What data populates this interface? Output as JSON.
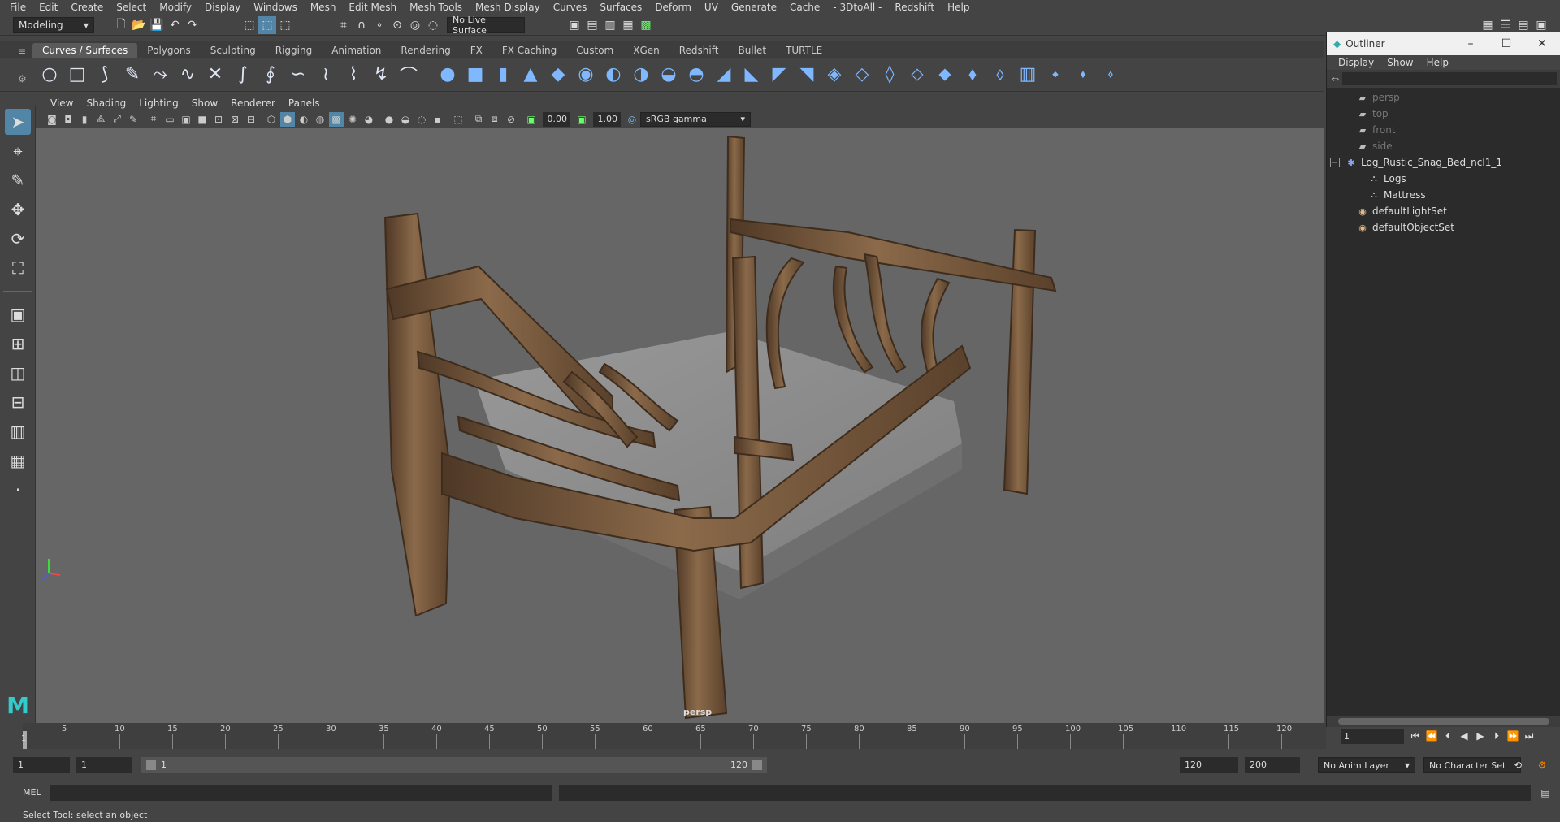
{
  "menubar": {
    "items": [
      "File",
      "Edit",
      "Create",
      "Select",
      "Modify",
      "Display",
      "Windows",
      "Mesh",
      "Edit Mesh",
      "Mesh Tools",
      "Mesh Display",
      "Curves",
      "Surfaces",
      "Deform",
      "UV",
      "Generate",
      "Cache",
      "- 3DtoAll -",
      "Redshift",
      "Help"
    ]
  },
  "status": {
    "mode": "Modeling",
    "live_surface": "No Live Surface"
  },
  "shelf": {
    "tabs": [
      "Curves / Surfaces",
      "Polygons",
      "Sculpting",
      "Rigging",
      "Animation",
      "Rendering",
      "FX",
      "FX Caching",
      "Custom",
      "XGen",
      "Redshift",
      "Bullet",
      "TURTLE"
    ],
    "active_tab": "Curves / Surfaces"
  },
  "viewport": {
    "menu": [
      "View",
      "Shading",
      "Lighting",
      "Show",
      "Renderer",
      "Panels"
    ],
    "exposure": "0.00",
    "gamma": "1.00",
    "color_space": "sRGB gamma",
    "camera_label": "persp"
  },
  "outliner": {
    "title": "Outliner",
    "menu": [
      "Display",
      "Show",
      "Help"
    ],
    "rows": [
      {
        "label": "persp",
        "icon": "camera-icon",
        "indent": 2,
        "dim": true
      },
      {
        "label": "top",
        "icon": "camera-icon",
        "indent": 2,
        "dim": true
      },
      {
        "label": "front",
        "icon": "camera-icon",
        "indent": 2,
        "dim": true
      },
      {
        "label": "side",
        "icon": "camera-icon",
        "indent": 2,
        "dim": true
      },
      {
        "label": "Log_Rustic_Snag_Bed_ncl1_1",
        "icon": "group-icon",
        "indent": 1,
        "dim": false,
        "expand": "−"
      },
      {
        "label": "Logs",
        "icon": "mesh-icon",
        "indent": 3,
        "dim": false
      },
      {
        "label": "Mattress",
        "icon": "mesh-icon",
        "indent": 3,
        "dim": false
      },
      {
        "label": "defaultLightSet",
        "icon": "set-icon",
        "indent": 2,
        "dim": false
      },
      {
        "label": "defaultObjectSet",
        "icon": "set-icon",
        "indent": 2,
        "dim": false
      }
    ]
  },
  "timeline": {
    "ticks": [
      "5",
      "10",
      "15",
      "20",
      "25",
      "30",
      "35",
      "40",
      "45",
      "50",
      "55",
      "60",
      "65",
      "70",
      "75",
      "80",
      "85",
      "90",
      "95",
      "100",
      "105",
      "110",
      "115",
      "120"
    ],
    "start_label": "1",
    "current_frame": "1"
  },
  "range": {
    "start": "1",
    "playback_start": "1",
    "slider_start": "1",
    "slider_end": "120",
    "playback_end": "120",
    "end": "200",
    "anim_layer": "No Anim Layer",
    "character_set": "No Character Set"
  },
  "cmdline": {
    "label": "MEL"
  },
  "helpline": {
    "text": "Select Tool: select an object"
  },
  "colors": {
    "wood": "#6e5238",
    "wood_light": "#8b6a4a",
    "mattress": "#8e8e8e",
    "accent": "#5285a6"
  }
}
